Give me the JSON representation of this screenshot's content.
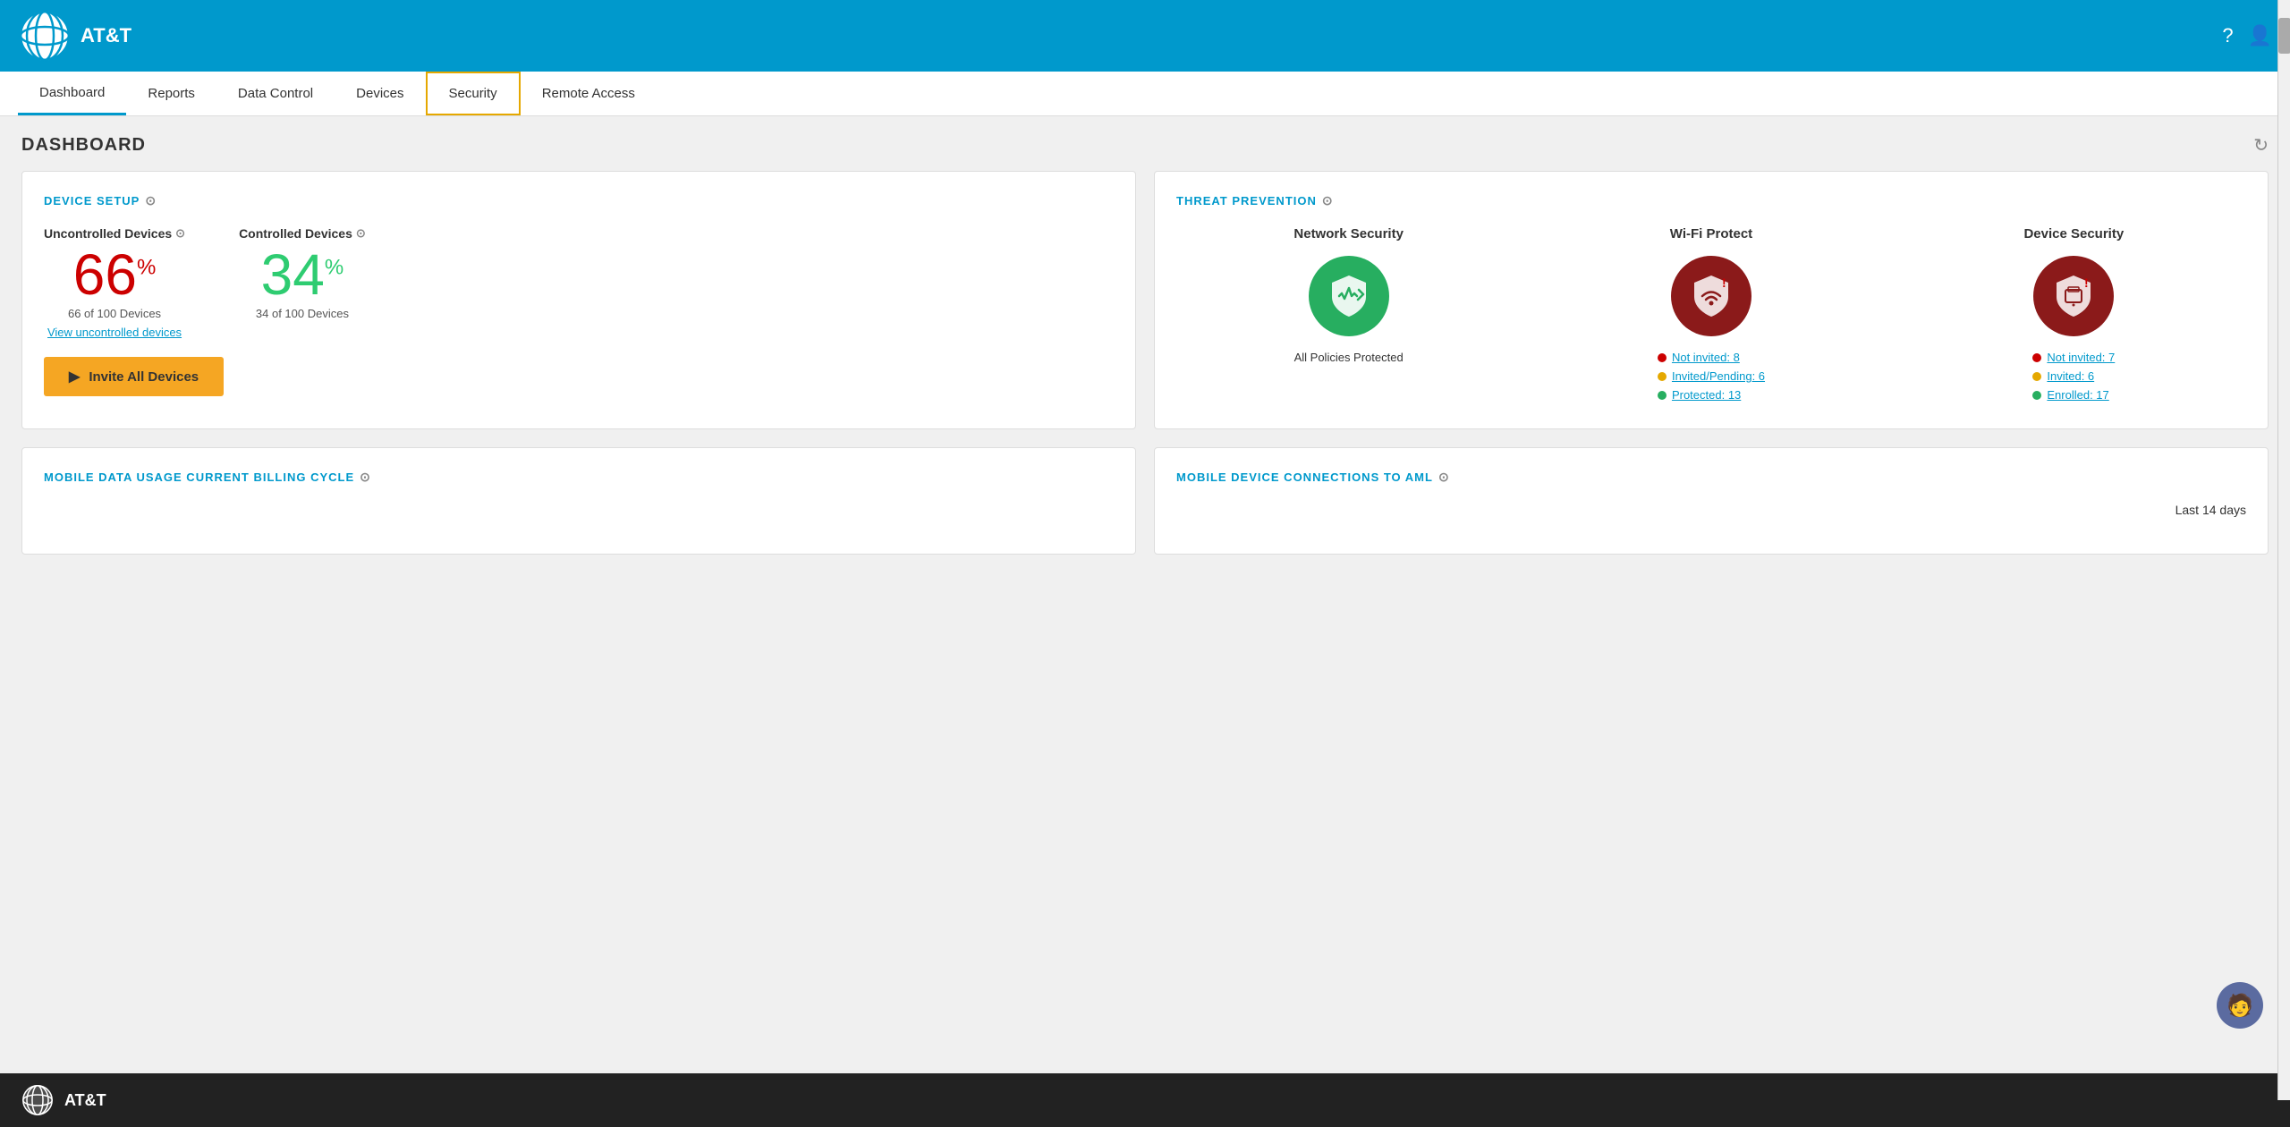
{
  "header": {
    "logo_alt": "AT&T Logo",
    "brand_name": "AT&T",
    "help_icon": "?",
    "user_icon": "👤"
  },
  "nav": {
    "items": [
      {
        "id": "dashboard",
        "label": "Dashboard",
        "active": true,
        "highlighted": false
      },
      {
        "id": "reports",
        "label": "Reports",
        "active": false,
        "highlighted": false
      },
      {
        "id": "data-control",
        "label": "Data Control",
        "active": false,
        "highlighted": false
      },
      {
        "id": "devices",
        "label": "Devices",
        "active": false,
        "highlighted": false
      },
      {
        "id": "security",
        "label": "Security",
        "active": false,
        "highlighted": true
      },
      {
        "id": "remote-access",
        "label": "Remote Access",
        "active": false,
        "highlighted": false
      }
    ]
  },
  "page_title": "DASHBOARD",
  "refresh_icon": "↻",
  "device_setup": {
    "title": "DEVICE SETUP",
    "help_icon": "?",
    "uncontrolled": {
      "label": "Uncontrolled Devices",
      "help_icon": "?",
      "percent": "66",
      "suffix": "%",
      "count": "66 of 100 Devices",
      "view_link": "View uncontrolled devices"
    },
    "controlled": {
      "label": "Controlled Devices",
      "help_icon": "?",
      "percent": "34",
      "suffix": "%",
      "count": "34 of 100 Devices"
    },
    "invite_button": "Invite All Devices"
  },
  "threat_prevention": {
    "title": "THREAT PREVENTION",
    "help_icon": "?",
    "columns": [
      {
        "id": "network-security",
        "title": "Network Security",
        "icon_type": "green",
        "icon_symbol": "🛡",
        "status_text": "All Policies Protected",
        "items": []
      },
      {
        "id": "wifi-protect",
        "title": "Wi-Fi Protect",
        "icon_type": "red",
        "icon_symbol": "📶",
        "status_text": "",
        "items": [
          {
            "dot": "red",
            "label": "Not invited:",
            "value": "8",
            "link": true
          },
          {
            "dot": "orange",
            "label": "Invited/Pending:",
            "value": "6",
            "link": true
          },
          {
            "dot": "green",
            "label": "Protected:",
            "value": "13",
            "link": true
          }
        ]
      },
      {
        "id": "device-security",
        "title": "Device Security",
        "icon_type": "red",
        "icon_symbol": "🔒",
        "status_text": "",
        "items": [
          {
            "dot": "red",
            "label": "Not invited:",
            "value": "7",
            "link": true
          },
          {
            "dot": "orange",
            "label": "Invited:",
            "value": "6",
            "link": true
          },
          {
            "dot": "green",
            "label": "Enrolled:",
            "value": "17",
            "link": true
          }
        ]
      }
    ]
  },
  "bottom_cards": [
    {
      "id": "mobile-data",
      "title": "MOBILE DATA USAGE CURRENT BILLING CYCLE",
      "help_icon": "?"
    },
    {
      "id": "mobile-device",
      "title": "MOBILE DEVICE CONNECTIONS TO AML",
      "help_icon": "?",
      "subtitle": "Last 14 days"
    }
  ],
  "footer": {
    "brand_name": "AT&T"
  },
  "chat_icon": "🧑"
}
